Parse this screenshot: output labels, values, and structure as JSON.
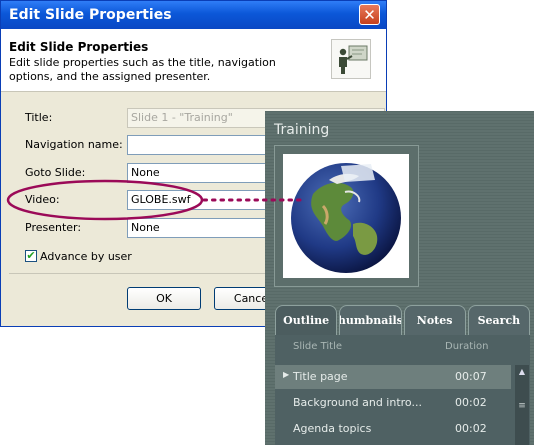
{
  "dialog": {
    "title": "Edit Slide Properties",
    "header_title": "Edit Slide Properties",
    "header_desc": "Edit slide properties such as the title, navigation options, and the assigned presenter.",
    "fields": {
      "title_label": "Title:",
      "title_value": "Slide 1 - \"Training\"",
      "nav_label": "Navigation name:",
      "nav_value": "",
      "goto_label": "Goto Slide:",
      "goto_value": "None",
      "video_label": "Video:",
      "video_value": "GLOBE.swf",
      "presenter_label": "Presenter:",
      "presenter_value": "None"
    },
    "advance_label": "Advance by user",
    "ok_label": "OK",
    "cancel_label": "Cance"
  },
  "player": {
    "title": "Training",
    "tabs": [
      "Outline",
      "humbnails",
      "Notes",
      "Search"
    ],
    "columns": {
      "title": "Slide Title",
      "duration": "Duration"
    },
    "rows": [
      {
        "title": "Title page",
        "duration": "00:07"
      },
      {
        "title": "Background and intro...",
        "duration": "00:02"
      },
      {
        "title": "Agenda topics",
        "duration": "00:02"
      }
    ]
  },
  "colors": {
    "callout": "#9b0a58",
    "titlebar": "#0a57d8"
  }
}
